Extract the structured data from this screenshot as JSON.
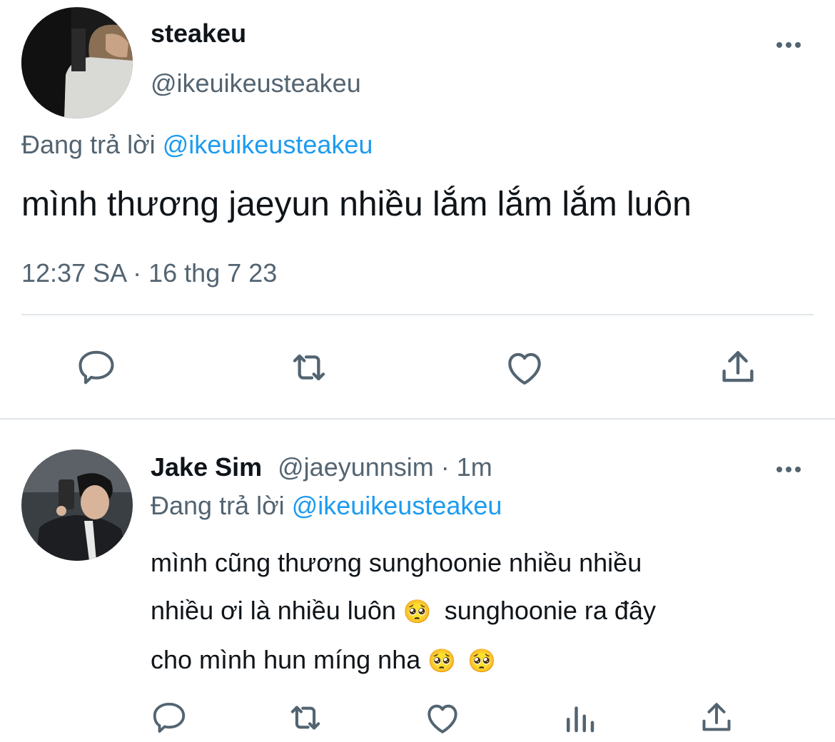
{
  "main_tweet": {
    "display_name": "steakeu",
    "handle": "@ikeuikeusteakeu",
    "reply_prefix": "Đang trả lời",
    "reply_to": "@ikeuikeusteakeu",
    "text": "mình thương jaeyun nhiều lắm lắm lắm luôn",
    "timestamp": "12:37 SA · 16 thg 7 23",
    "actions": [
      "reply-icon",
      "retweet-icon",
      "like-icon",
      "share-icon"
    ]
  },
  "reply_tweet": {
    "display_name": "Jake Sim",
    "handle": "@jaeyunnsim",
    "time": "· 1m",
    "reply_prefix": "Đang trả lời",
    "reply_to": "@ikeuikeusteakeu",
    "line1": "mình cũng thương sunghoonie nhiều nhiều",
    "line2a": "nhiều ơi là nhiều luôn",
    "line2b": "sunghoonie ra đây",
    "line3": "cho mình hun míng nha",
    "emoji": "🥺",
    "actions": [
      "reply-icon",
      "retweet-icon",
      "like-icon",
      "analytics-icon",
      "share-icon"
    ]
  },
  "colors": {
    "text": "#0f1419",
    "muted": "#536471",
    "link": "#1d9bf0",
    "divider": "#e1e6ea"
  }
}
